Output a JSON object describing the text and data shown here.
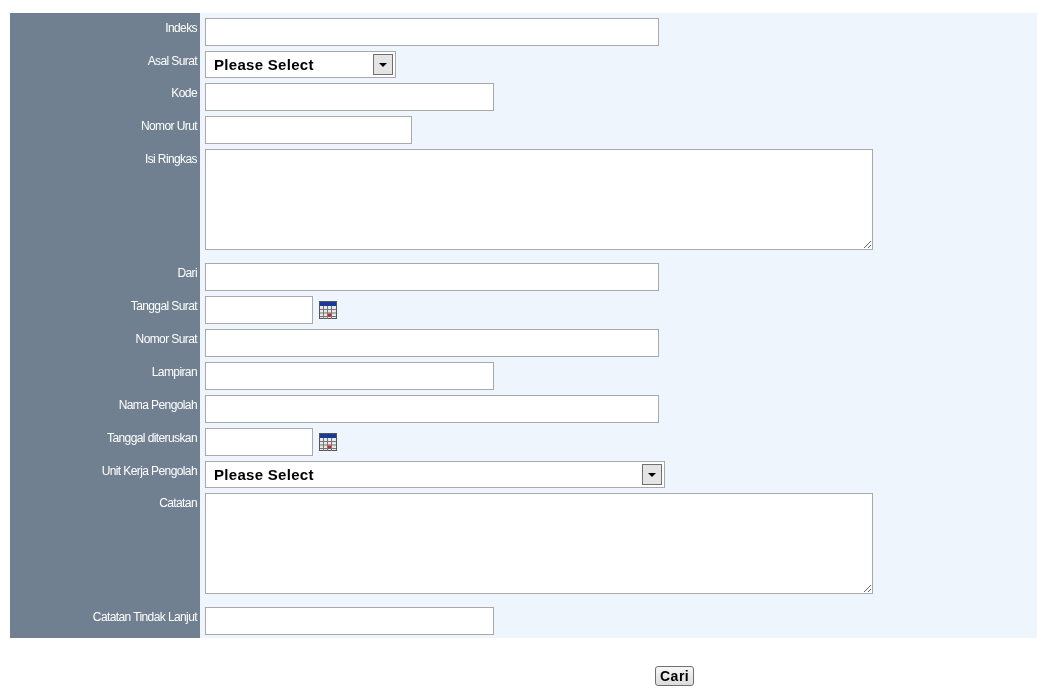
{
  "form": {
    "fields": [
      {
        "label": "Indeks",
        "kind": "text"
      },
      {
        "label": "Asal Surat",
        "kind": "select",
        "value": "Please Select"
      },
      {
        "label": "Kode",
        "kind": "text"
      },
      {
        "label": "Nomor Urut",
        "kind": "text"
      },
      {
        "label": "Isi Ringkas",
        "kind": "textarea"
      },
      {
        "label": "Dari",
        "kind": "text"
      },
      {
        "label": "Tanggal Surat",
        "kind": "date"
      },
      {
        "label": "Nomor Surat",
        "kind": "text"
      },
      {
        "label": "Lampiran",
        "kind": "text"
      },
      {
        "label": "Nama Pengolah",
        "kind": "text"
      },
      {
        "label": "Tanggal diteruskan",
        "kind": "date"
      },
      {
        "label": "Unit Kerja Pengolah",
        "kind": "select",
        "value": "Please Select"
      },
      {
        "label": "Catatan",
        "kind": "textarea"
      },
      {
        "label": "Catatan Tindak Lanjut",
        "kind": "text"
      }
    ]
  },
  "buttons": [
    {
      "label": "Cari"
    }
  ]
}
